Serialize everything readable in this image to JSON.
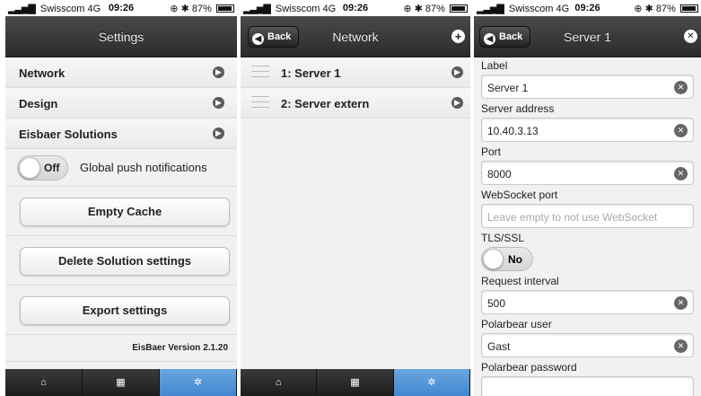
{
  "status": {
    "carrier": "Swisscom",
    "network": "4G",
    "time": "09:26",
    "battery": "87%",
    "signal_glyph": "▂▃▅▇",
    "right_icons": "⊕ ✱"
  },
  "settings": {
    "title": "Settings",
    "items": [
      {
        "label": "Network"
      },
      {
        "label": "Design"
      },
      {
        "label": "Eisbaer Solutions"
      }
    ],
    "push": {
      "state": "Off",
      "label": "Global push notifications"
    },
    "buttons": {
      "empty_cache": "Empty Cache",
      "delete_solution": "Delete Solution settings",
      "export": "Export settings"
    },
    "version": "EisBaer Version 2.1.20"
  },
  "network": {
    "title": "Network",
    "back": "Back",
    "servers": [
      {
        "label": "1: Server 1"
      },
      {
        "label": "2: Server extern"
      }
    ]
  },
  "server": {
    "title": "Server 1",
    "back": "Back",
    "fields": {
      "label": {
        "label": "Label",
        "value": "Server 1"
      },
      "address": {
        "label": "Server address",
        "value": "10.40.3.13"
      },
      "port": {
        "label": "Port",
        "value": "8000"
      },
      "websocket": {
        "label": "WebSocket port",
        "placeholder": "Leave empty to not use WebSocket"
      },
      "tls": {
        "label": "TLS/SSL",
        "state": "No"
      },
      "interval": {
        "label": "Request interval",
        "value": "500"
      },
      "user": {
        "label": "Polarbear user",
        "value": "Gast"
      },
      "password": {
        "label": "Polarbear password"
      }
    }
  },
  "icons": {
    "back": "chevron-left-icon",
    "arrow": "chevron-right-icon",
    "add": "plus-icon",
    "close": "close-icon",
    "clear": "clear-icon",
    "home": "home-icon",
    "grid": "grid-icon",
    "gear": "gear-icon"
  },
  "colors": {
    "header": "#2b2b2b",
    "tab_active": "#4287cf"
  }
}
